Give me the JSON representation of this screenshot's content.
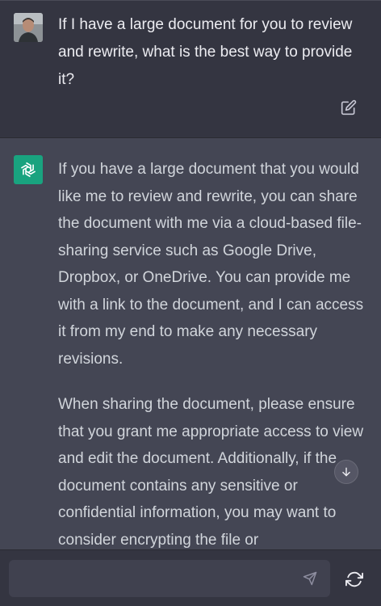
{
  "user_message": {
    "text": "If I have a large document for you to review and rewrite, what is the best way to provide it?"
  },
  "assistant_message": {
    "paragraphs": [
      "If you have a large document that you would like me to review and rewrite, you can share the document with me via a cloud-based file-sharing service such as Google Drive, Dropbox, or OneDrive. You can provide me with a link to the document, and I can access it from my end to make any necessary revisions.",
      "When sharing the document, please ensure that you grant me appropriate access to view and edit the document. Additionally, if the document contains any sensitive or confidential information, you may want to consider encrypting the file or"
    ]
  },
  "composer": {
    "value": "",
    "placeholder": ""
  },
  "icons": {
    "edit": "edit-icon",
    "assistant": "openai-logo-icon",
    "scroll_down": "arrow-down-icon",
    "send": "send-icon",
    "regenerate": "refresh-icon"
  },
  "colors": {
    "background": "#343541",
    "assistant_background": "#444654",
    "assistant_avatar": "#19a37f",
    "text": "#ececf1"
  }
}
